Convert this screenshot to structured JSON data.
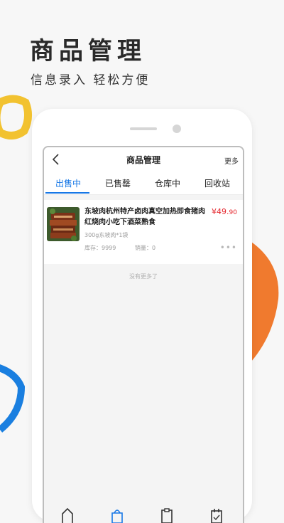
{
  "hero": {
    "title": "商品管理",
    "subtitle": "信息录入 轻松方便"
  },
  "colors": {
    "accent": "#1677e6",
    "price": "#e5262d",
    "yellow_deco": "#f2c230",
    "orange_deco": "#f07a2e",
    "blue_deco": "#1a7fe0"
  },
  "app": {
    "topbar": {
      "back_icon": "chevron-left-icon",
      "title": "商品管理",
      "more": "更多"
    },
    "tabs": [
      {
        "label": "出售中",
        "active": true
      },
      {
        "label": "已售罄",
        "active": false
      },
      {
        "label": "仓库中",
        "active": false
      },
      {
        "label": "回收站",
        "active": false
      }
    ],
    "product": {
      "title": "东坡肉杭州特产卤肉真空加热即食猪肉红烧肉小吃下酒菜熟食",
      "price_main": "¥49.",
      "price_cents": "90",
      "spec": "300g东坡肉*1袋",
      "stock": "库存：9999",
      "sales": "销量：0",
      "more_icon": "more-dots-icon"
    },
    "footer_note": "没有更多了",
    "bottom_nav_icons": [
      "home-icon",
      "bag-icon",
      "clipboard-icon",
      "calendar-check-icon"
    ]
  }
}
